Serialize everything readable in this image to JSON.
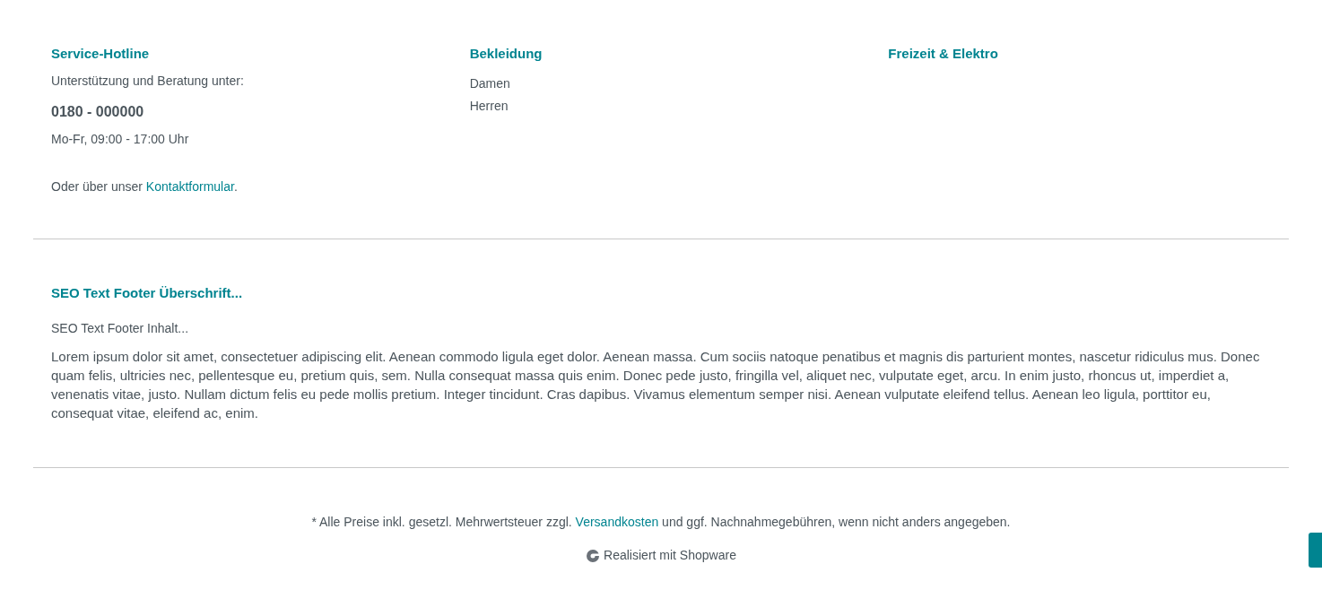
{
  "columns": [
    {
      "title": "Service-Hotline",
      "kind": "hotline",
      "intro": "Unterstützung und Beratung unter:",
      "phone": "0180 - 000000",
      "hours": "Mo-Fr, 09:00 - 17:00 Uhr",
      "contact": {
        "before": "Oder über unser ",
        "link": "Kontaktformular",
        "after": "."
      }
    },
    {
      "title": "Bekleidung",
      "kind": "links",
      "items": [
        "Damen",
        "Herren"
      ]
    },
    {
      "title": "Freizeit & Elektro",
      "kind": "links"
    }
  ],
  "seo": {
    "title": "SEO Text Footer Überschrift...",
    "subtitle": "SEO Text Footer Inhalt...",
    "body": "Lorem ipsum dolor sit amet, consectetuer adipiscing elit. Aenean commodo ligula eget dolor. Aenean massa. Cum sociis natoque penatibus et magnis dis parturient montes, nascetur ridiculus mus. Donec quam felis, ultricies nec, pellentesque eu, pretium quis, sem. Nulla consequat massa quis enim. Donec pede justo, fringilla vel, aliquet nec, vulputate eget, arcu. In enim justo, rhoncus ut, imperdiet a, venenatis vitae, justo. Nullam dictum felis eu pede mollis pretium. Integer tincidunt. Cras dapibus. Vivamus elementum semper nisi. Aenean vulputate eleifend tellus. Aenean leo ligula, porttitor eu, consequat vitae, eleifend ac, enim."
  },
  "vat_note": {
    "before": "* Alle Preise inkl. gesetzl. Mehrwertsteuer zzgl. ",
    "link": "Versandkosten",
    "after": " und ggf. Nachnahmegebühren, wenn nicht anders angegeben."
  },
  "powered_by": "Realisiert mit Shopware"
}
